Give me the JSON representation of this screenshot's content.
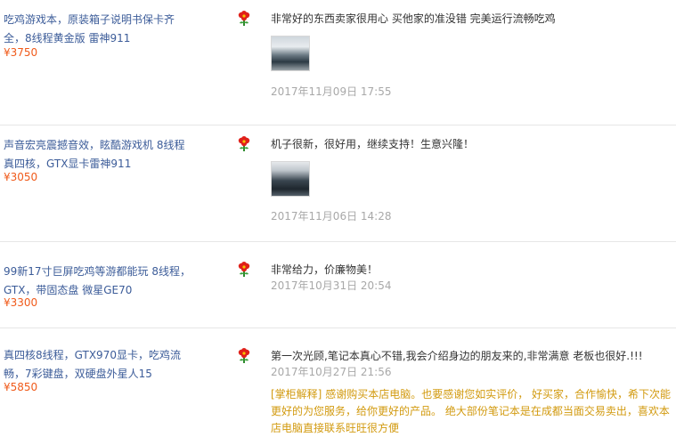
{
  "reviews": [
    {
      "item_title": "吃鸡游戏本，原装箱子说明书保卡齐全，8线程黄金版 雷神911",
      "price": "¥3750",
      "comment": "非常好的东西卖家很用心 买他家的准没错 完美运行流畅吃鸡",
      "date": "2017年11月09日 17:55"
    },
    {
      "item_title": "声音宏亮震撼音效，眩酷游戏机 8线程真四核，GTX显卡雷神911",
      "price": "¥3050",
      "comment": "机子很新，很好用，继续支持！生意兴隆！",
      "date": "2017年11月06日 14:28"
    },
    {
      "item_title": "99新17寸巨屏吃鸡等游都能玩 8线程，GTX，带固态盘 微星GE70",
      "price": "¥3300",
      "comment": "非常给力，价廉物美！",
      "date": "2017年10月31日 20:54"
    },
    {
      "item_title": "真四核8线程，GTX970显卡，吃鸡流畅，7彩键盘，双硬盘外星人15",
      "price": "¥5850",
      "comment": "第一次光顾,笔记本真心不错,我会介绍身边的朋友来的,非常满意 老板也很好.!!!",
      "date": "2017年10月27日 21:56",
      "reply_label": "[掌柜解释]",
      "reply": "感谢购买本店电脑。也要感谢您如实评价， 好买家，合作愉快，希下次能更好的为您服务，给你更好的产品。 绝大部份笔记本是在成都当面交易卖出，喜欢本店电脑直接联系旺旺很方便"
    }
  ],
  "icons": {
    "rating": "red-flower-icon",
    "photo": "review-photo-thumbnail"
  },
  "colors": {
    "link": "#3c5c99",
    "price": "#f05a1a",
    "date": "#a8a8a8",
    "reply": "#d29a0f",
    "flower": "#e0201a"
  }
}
